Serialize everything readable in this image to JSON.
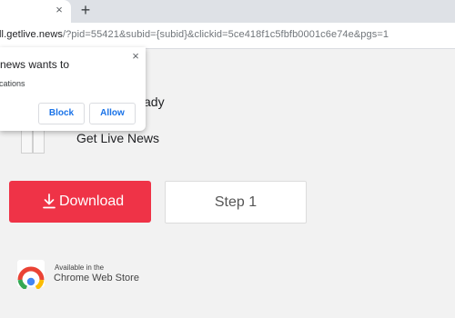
{
  "browser": {
    "tab_close_glyph": "×",
    "new_tab_glyph": "+",
    "url_host": "ll.getlive.news",
    "url_path": "/?pid=55421&subid={subid}&clickid=5ce418f1c5fbfb0001c6e74e&pgs=1"
  },
  "popup": {
    "title": "news wants to",
    "subtitle": "cations",
    "close_glyph": "×",
    "block_label": "Block",
    "allow_label": "Allow",
    "button_color": "#1a73e8"
  },
  "page": {
    "fragment_text": "ady",
    "brand_name": "Get Live News",
    "download_label": "Download",
    "download_color": "#ef3347",
    "step_label": "Step 1",
    "store_small": "Available in the",
    "store_big": "Chrome Web Store"
  },
  "icons": {
    "download": "download-arrow-icon",
    "store": "chrome-logo-icon"
  }
}
